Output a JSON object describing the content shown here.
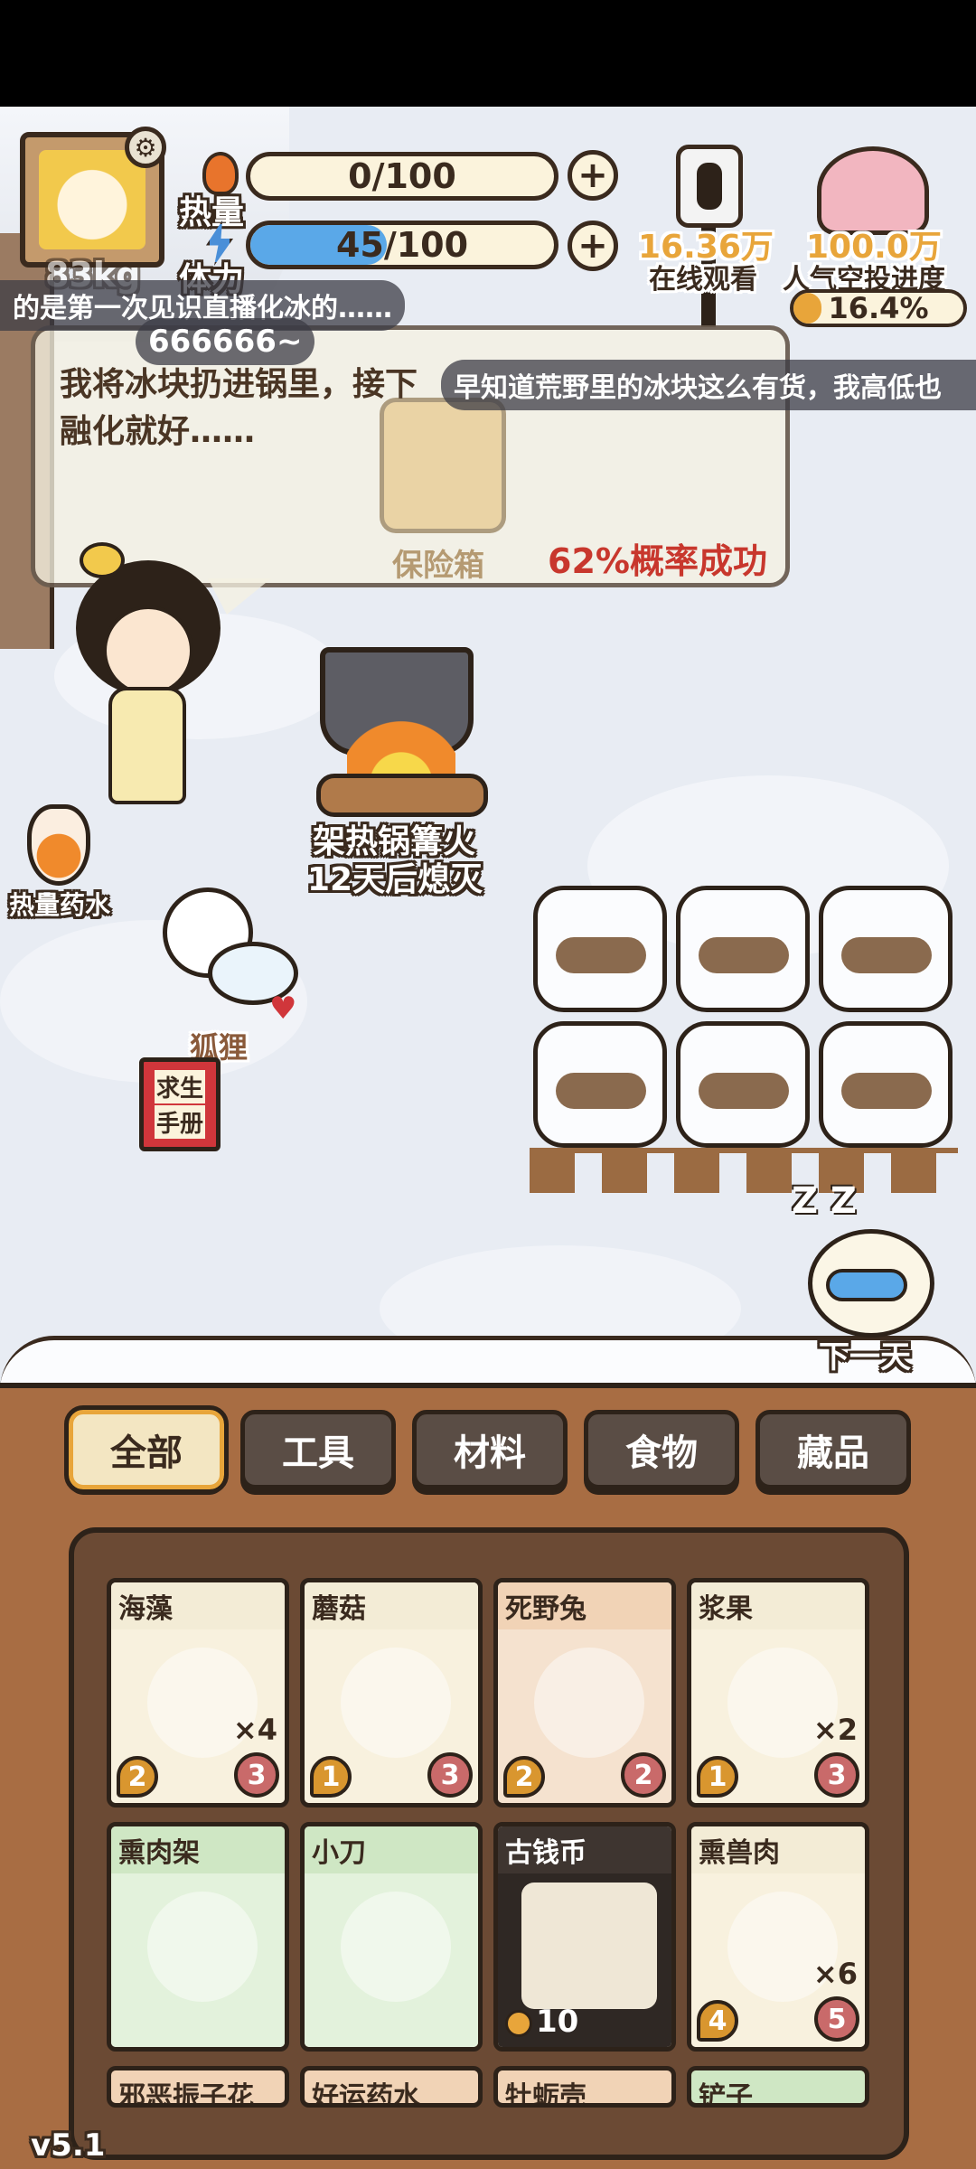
{
  "hud": {
    "heat_label": "热量",
    "stamina_label": "体力",
    "heat_value": "0/100",
    "heat_fraction": 0.0,
    "stamina_value": "45/100",
    "stamina_fraction": 0.45,
    "weight": "83kg",
    "viewers_value": "16.36万",
    "viewers_label": "在线观看",
    "popularity_value": "100.0万",
    "popularity_label": "人气空投进度",
    "airdrop_percent": "16.4%",
    "airdrop_fraction": 0.164
  },
  "danmaku": [
    "的是第一次见识直播化冰的……",
    "666666~",
    "早知道荒野里的冰块这么有货，我高低也"
  ],
  "dialog": {
    "line1": "我将冰块扔进锅里，接下",
    "line2": "融化就好……",
    "chance": "62%概率成功"
  },
  "scene": {
    "safe_label": "保险箱",
    "campfire_label": "架热锅篝火",
    "campfire_timer": "12天后熄灭",
    "potion_label": "热量药水",
    "fox_label": "狐狸",
    "manual_line1": "求生",
    "manual_line2": "手册",
    "next_day_label": "下一天",
    "sleep_text": "Z Z"
  },
  "tabs": [
    "全部",
    "工具",
    "材料",
    "食物",
    "藏品"
  ],
  "active_tab": "全部",
  "inventory": [
    {
      "name": "海藻",
      "qty": "×4",
      "left": "2",
      "right": "3",
      "color": "#f3ecd6"
    },
    {
      "name": "蘑菇",
      "qty": "",
      "left": "1",
      "right": "3",
      "color": "#f3ecd6"
    },
    {
      "name": "死野兔",
      "qty": "",
      "left": "2",
      "right": "2",
      "color": "#f1d3b6"
    },
    {
      "name": "浆果",
      "qty": "×2",
      "left": "1",
      "right": "3",
      "color": "#f3ecd6"
    },
    {
      "name": "熏肉架",
      "qty": "",
      "left": "",
      "right": "",
      "color": "#cfe7c4"
    },
    {
      "name": "小刀",
      "qty": "",
      "left": "",
      "right": "",
      "color": "#cfe7c4"
    },
    {
      "name": "古钱币",
      "qty": "",
      "coin": "10",
      "left": "",
      "right": "",
      "color": "#3e3530"
    },
    {
      "name": "熏兽肉",
      "qty": "×6",
      "left": "4",
      "right": "5",
      "color": "#f3ecd6"
    },
    {
      "name": "邪恶振子花",
      "color": "#f1d3b6"
    },
    {
      "name": "好运药水",
      "color": "#f1d3b6"
    },
    {
      "name": "牡蛎壳",
      "color": "#f1d3b6"
    },
    {
      "name": "铲子",
      "color": "#cfe7c4"
    }
  ],
  "version": "v5.1",
  "colors": {
    "stamina_fill": "#5aa8e8",
    "chance_text": "#c8372d",
    "wood": "#8a5a3a",
    "active_tab_border": "#e8a53a"
  }
}
